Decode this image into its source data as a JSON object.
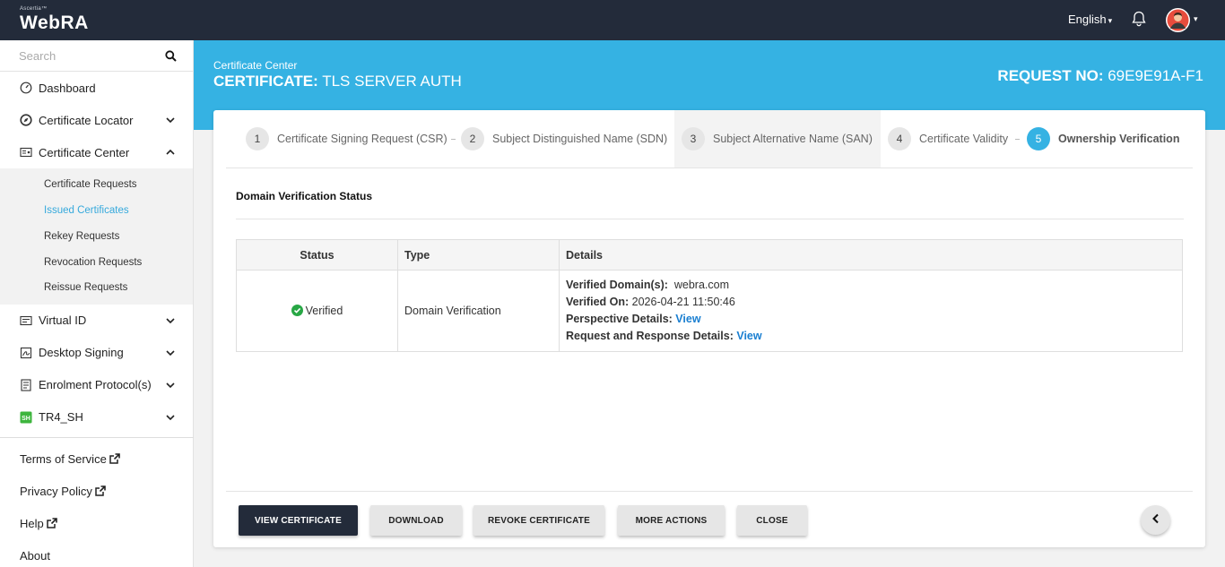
{
  "app": {
    "brand_tm": "Ascertia™",
    "brand_name": "WebRA"
  },
  "topbar": {
    "language": "English",
    "language_caret": "▾",
    "avatar_caret": "▾"
  },
  "sidebar": {
    "search_placeholder": "Search",
    "items": [
      {
        "label": "Dashboard",
        "icon": "dashboard-icon"
      },
      {
        "label": "Certificate Locator",
        "icon": "compass-icon"
      },
      {
        "label": "Certificate Center",
        "icon": "certificate-icon"
      }
    ],
    "subitems": [
      {
        "label": "Certificate Requests"
      },
      {
        "label": "Issued Certificates"
      },
      {
        "label": "Rekey Requests"
      },
      {
        "label": "Revocation Requests"
      },
      {
        "label": "Reissue Requests"
      }
    ],
    "items2": [
      {
        "label": "Virtual ID",
        "icon": "id-card-icon"
      },
      {
        "label": "Desktop Signing",
        "icon": "signing-icon"
      },
      {
        "label": "Enrolment Protocol(s)",
        "icon": "protocol-icon"
      },
      {
        "label": "TR4_SH",
        "icon": "sh-badge-icon"
      }
    ],
    "footer": [
      {
        "label": "Terms of Service"
      },
      {
        "label": "Privacy Policy"
      },
      {
        "label": "Help"
      },
      {
        "label": "About"
      }
    ]
  },
  "header": {
    "breadcrumb": "Certificate Center",
    "title_bold": "CERTIFICATE:",
    "title_rest": " TLS SERVER AUTH",
    "request_label": "REQUEST NO:",
    "request_value": " 69E9E91A-F1"
  },
  "steps": [
    {
      "num": "1",
      "label": "Certificate Signing Request (CSR)"
    },
    {
      "num": "2",
      "label": "Subject Distinguished Name (SDN)"
    },
    {
      "num": "3",
      "label": "Subject Alternative Name (SAN)"
    },
    {
      "num": "4",
      "label": "Certificate Validity"
    },
    {
      "num": "5",
      "label": "Ownership Verification"
    }
  ],
  "section": {
    "title": "Domain Verification Status"
  },
  "table": {
    "headers": [
      "Status",
      "Type",
      "Details"
    ],
    "row": {
      "status": "Verified",
      "type": "Domain Verification",
      "details": {
        "domains_label": "Verified Domain(s):",
        "domains_value": "webra.com",
        "verified_on_label": "Verified On:",
        "verified_on_value": "2026-04-21 11:50:46",
        "perspective_label": "Perspective Details:",
        "perspective_link": "View",
        "reqresp_label": "Request and Response Details:",
        "reqresp_link": "View"
      }
    }
  },
  "buttons": {
    "view_certificate": "VIEW CERTIFICATE",
    "download": "DOWNLOAD",
    "revoke": "REVOKE CERTIFICATE",
    "more_actions": "MORE ACTIONS",
    "close": "CLOSE"
  },
  "colors": {
    "topbar": "#232b3a",
    "accent": "#35b2e3",
    "link": "#1a7fd1",
    "success": "#28a745",
    "active_sub": "#35a9dc"
  }
}
